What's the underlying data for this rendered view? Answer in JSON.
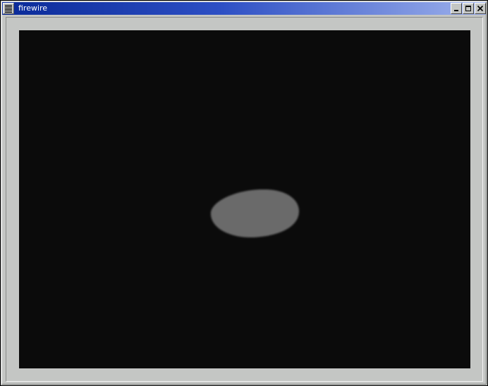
{
  "window": {
    "title": "firewire",
    "icons": {
      "menu": "window-menu-icon",
      "minimize": "minimize-icon",
      "maximize": "maximize-icon",
      "close": "close-icon"
    },
    "colors": {
      "titlebar_start": "#0a2a98",
      "titlebar_end": "#9fb2ec",
      "frame": "#c4c6c4",
      "video_background": "#0b0b0b",
      "blob": "#6a6a6a"
    }
  }
}
